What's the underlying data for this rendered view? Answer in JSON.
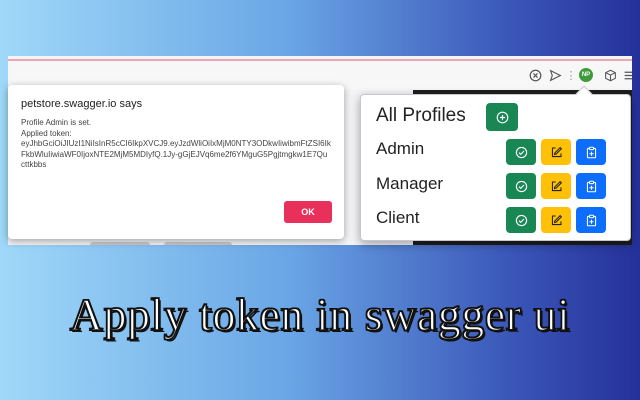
{
  "dialog": {
    "title": "petstore.swagger.io says",
    "line1": "Profile Admin is set.",
    "line2": "Applied token:",
    "token": "eyJhbGciOiJIUzI1NiIsInR5cCI6IkpXVCJ9.eyJzdWliOiIxMjM0NTY3ODkwIiwibmFtZSI6IkFkbWluIiwiaWF0IjoxNTE2MjM5MDIyfQ.1Jy-gGjEJVq6me2f6YMguG5Pgjtmgkw1E7Qucttkbbs",
    "ok_label": "OK"
  },
  "extension_icon_label": "NP",
  "popup": {
    "heading": "All Profiles",
    "profiles": [
      {
        "name": "Admin"
      },
      {
        "name": "Manager"
      },
      {
        "name": "Client"
      }
    ]
  },
  "caption": "Apply token in swagger ui",
  "colors": {
    "ok_button": "#e8305a",
    "green": "#198754",
    "yellow": "#ffc107",
    "blue": "#0d6efd"
  },
  "icons": {
    "add": "plus-circle-icon",
    "apply": "check-circle-icon",
    "edit": "pencil-square-icon",
    "copy": "clipboard-plus-icon"
  }
}
